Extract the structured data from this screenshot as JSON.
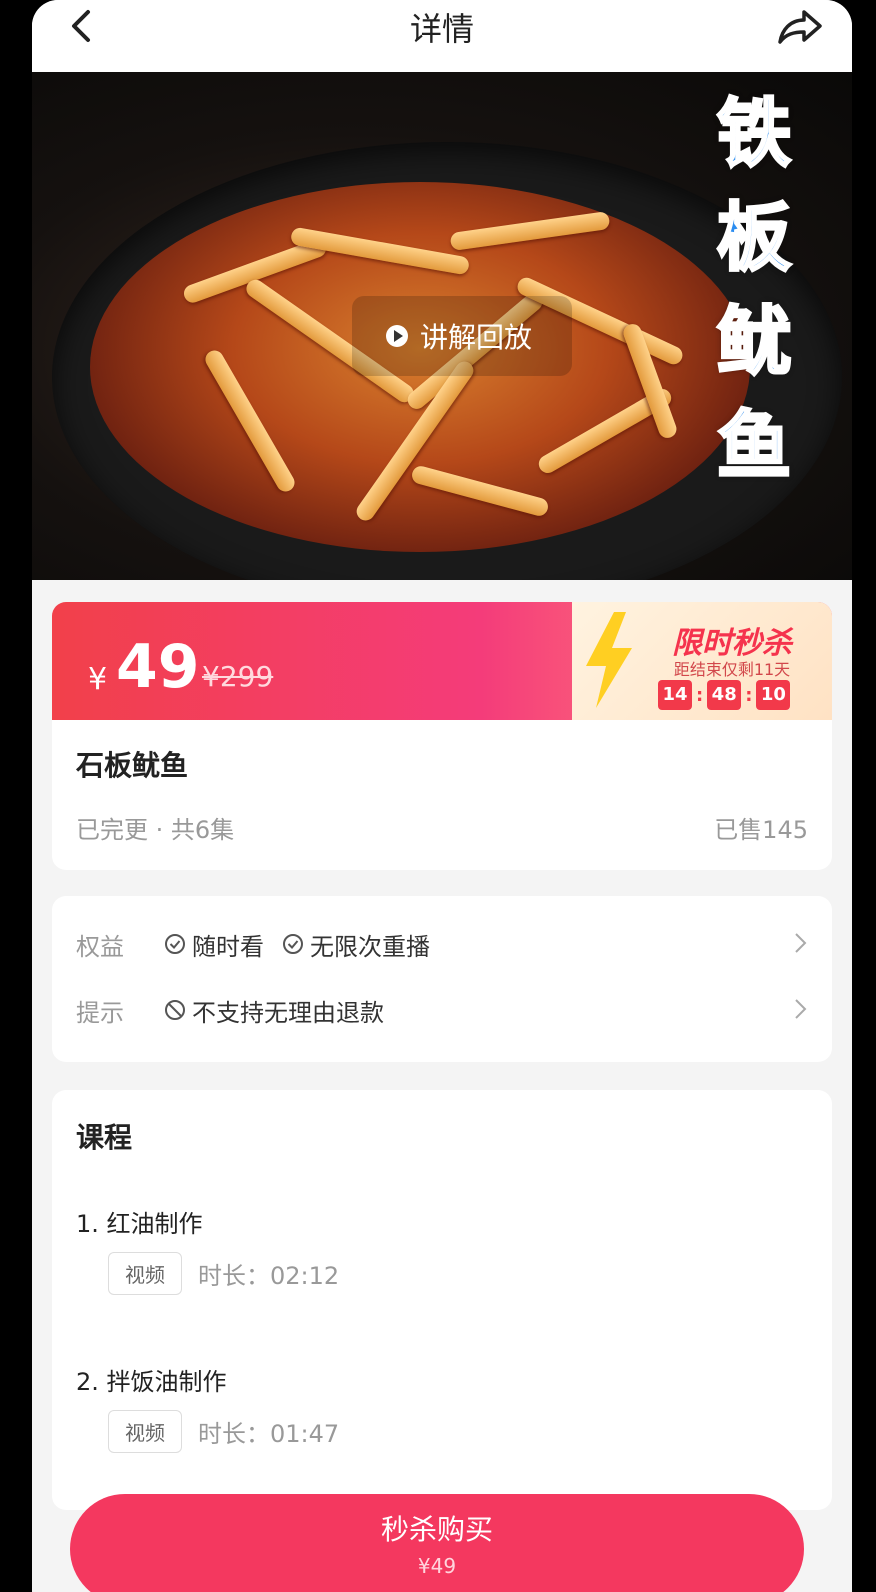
{
  "header": {
    "title": "详情",
    "back_icon": "back-arrow-icon",
    "share_icon": "share-icon"
  },
  "hero": {
    "play_label": "讲解回放",
    "overlay_title_chars": [
      "铁",
      "板",
      "鱿",
      "鱼"
    ],
    "overlay_title_color": "#2a8cf0"
  },
  "price": {
    "currency": "¥",
    "current": "49",
    "original": "¥299",
    "flash_title": "限时秒杀",
    "countdown_label": "距结束仅剩11天",
    "timer": {
      "hours": "14",
      "minutes": "48",
      "seconds": "10"
    },
    "accent_color": "#f4385f"
  },
  "product": {
    "name": "石板鱿鱼",
    "status": "已完更 · 共6集",
    "sold": "已售145"
  },
  "rights": {
    "benefits_label": "权益",
    "benefits": [
      "随时看",
      "无限次重播"
    ],
    "notice_label": "提示",
    "notice": "不支持无理由退款"
  },
  "course": {
    "title": "课程",
    "lessons": [
      {
        "title": "1. 红油制作",
        "type": "视频",
        "duration": "时长：02:12"
      },
      {
        "title": "2. 拌饭油制作",
        "type": "视频",
        "duration": "时长：01:47"
      }
    ]
  },
  "buy": {
    "label": "秒杀购买",
    "price": "¥49"
  }
}
